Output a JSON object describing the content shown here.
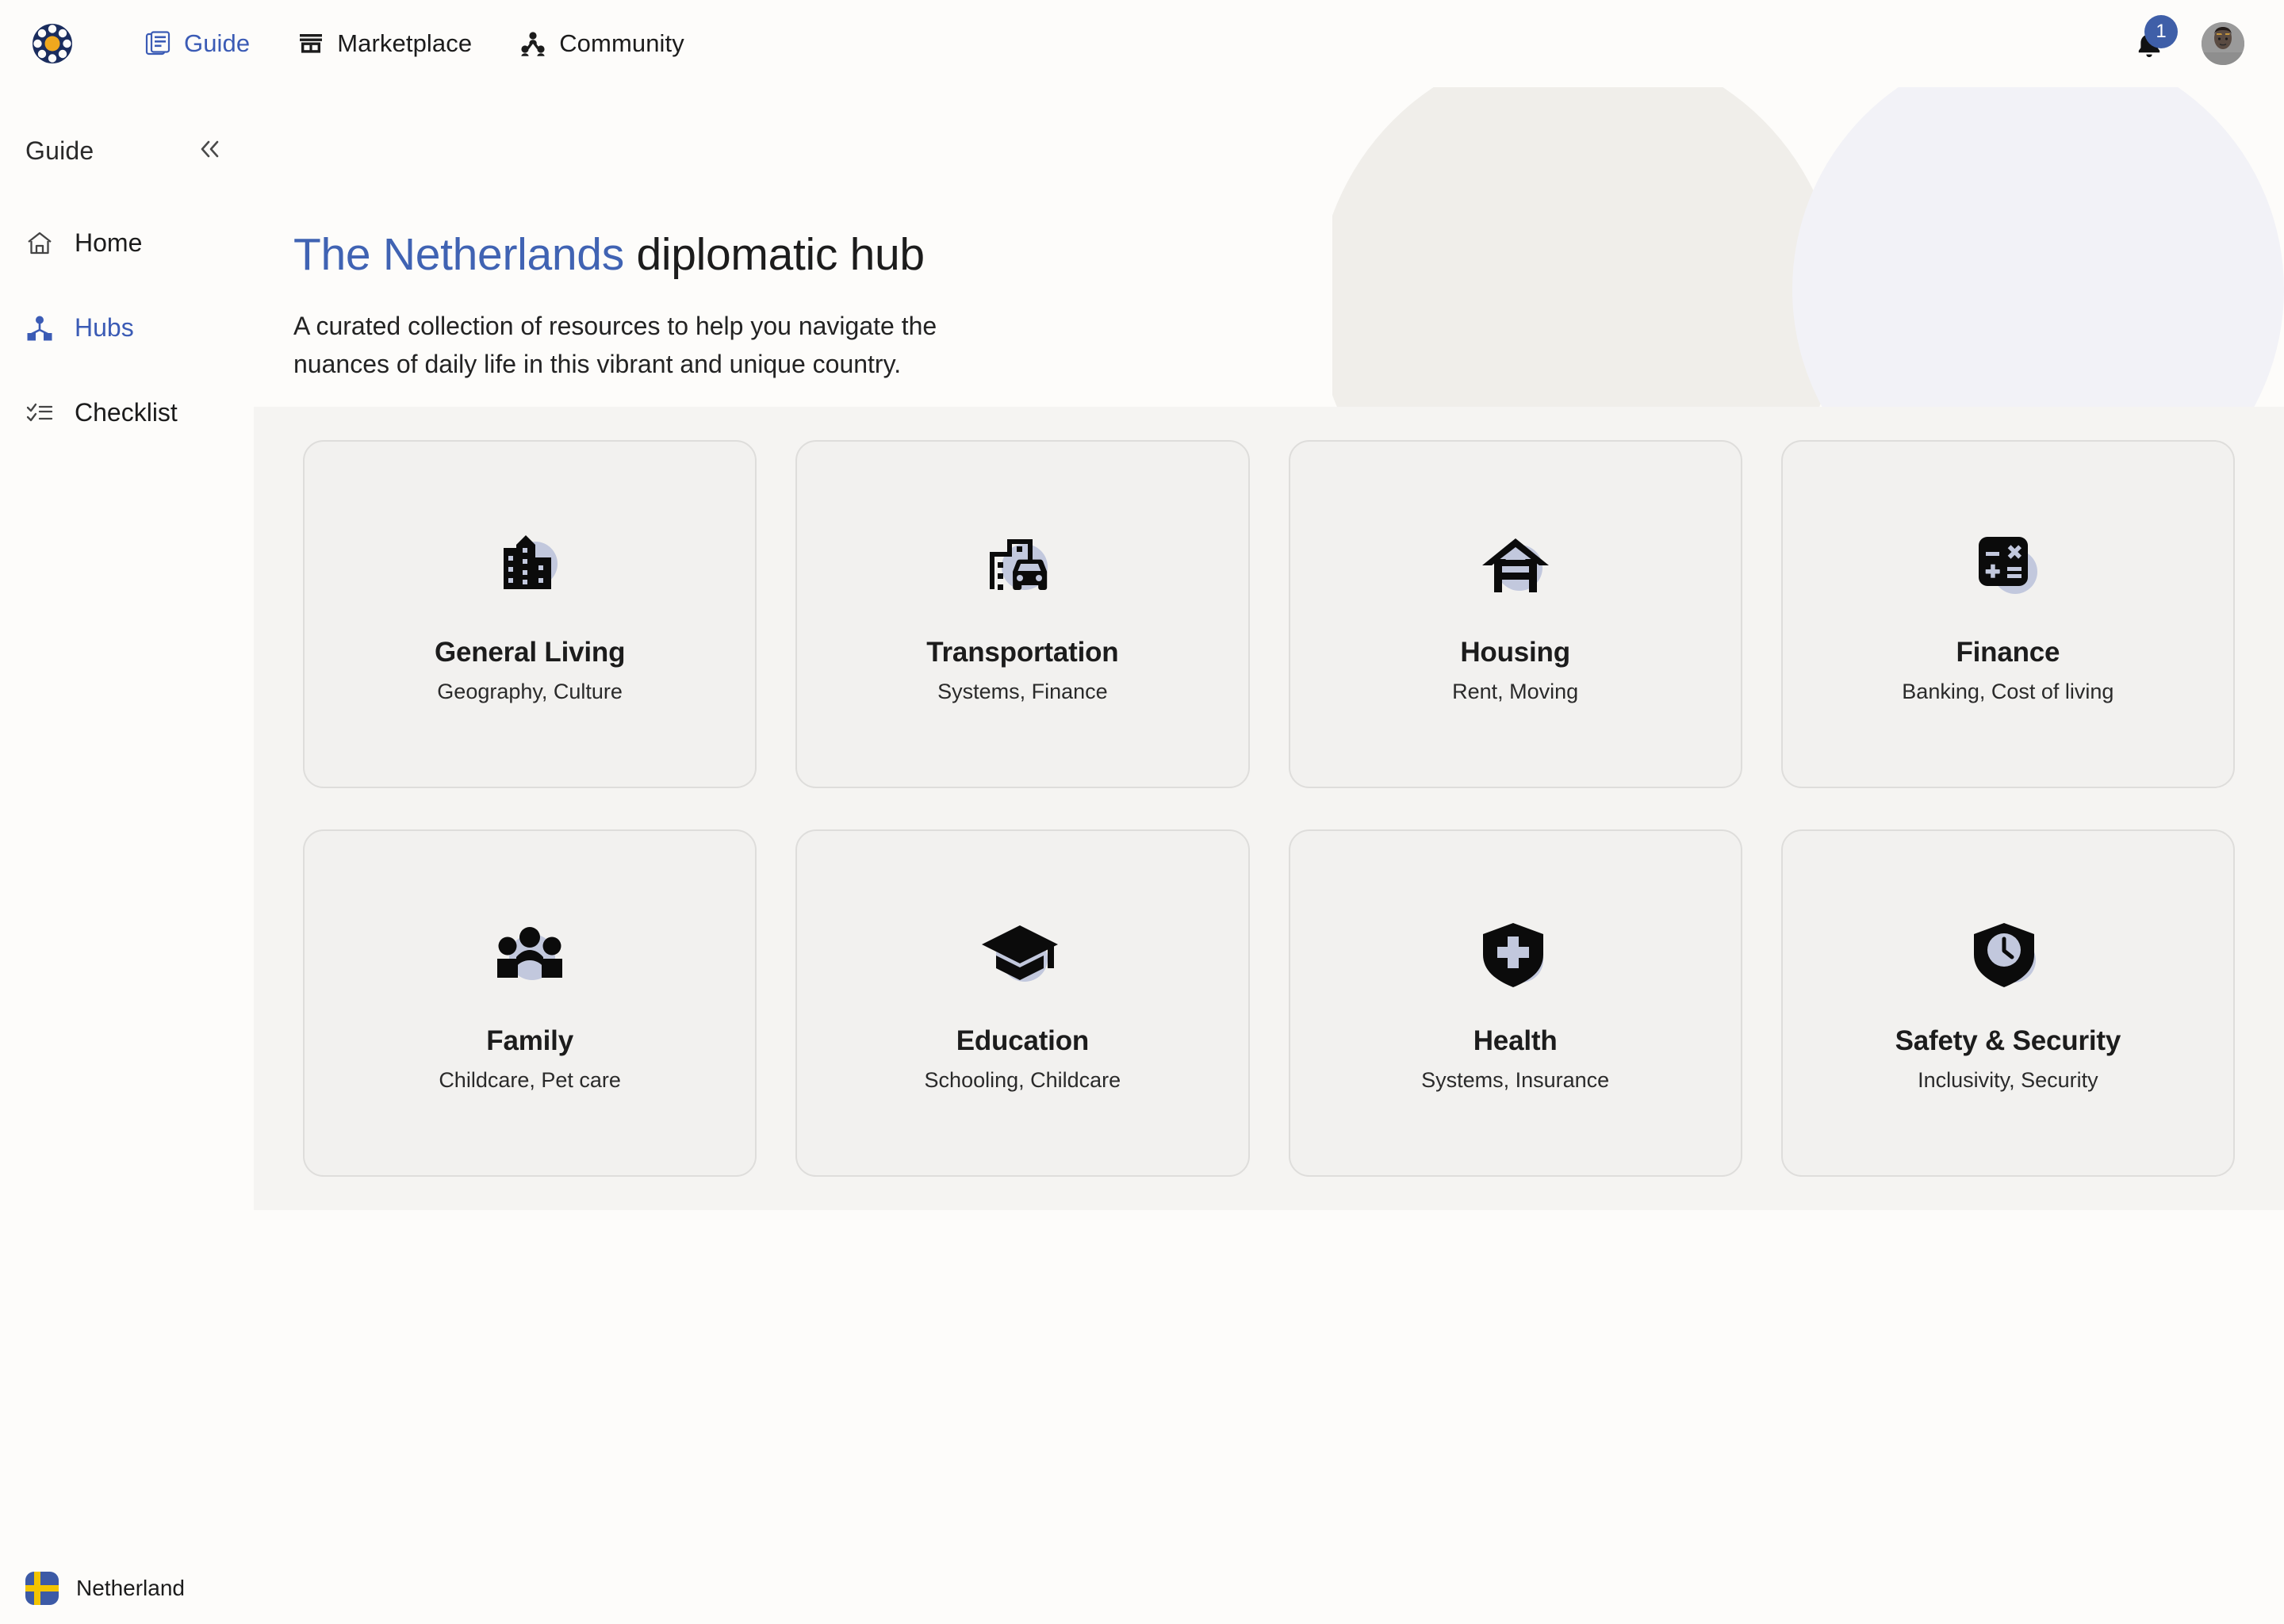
{
  "topnav": {
    "logo_icon": "app-logo-emblem",
    "items": [
      {
        "label": "Guide",
        "icon": "book-document-icon",
        "active": true
      },
      {
        "label": "Marketplace",
        "icon": "storefront-icon",
        "active": false
      },
      {
        "label": "Community",
        "icon": "people-group-icon",
        "active": false
      }
    ],
    "notifications": {
      "icon": "bell-icon",
      "count": "1",
      "badge_color": "#3f5fa8"
    },
    "avatar": {
      "icon": "user-avatar",
      "alt": "User profile"
    }
  },
  "sidebar": {
    "title": "Guide",
    "collapse_icon": "chevron-double-left-icon",
    "items": [
      {
        "label": "Home",
        "icon": "home-icon",
        "active": false
      },
      {
        "label": "Hubs",
        "icon": "hubs-network-icon",
        "active": true
      },
      {
        "label": "Checklist",
        "icon": "checklist-icon",
        "active": false
      }
    ]
  },
  "hero": {
    "title_highlight": "The Netherlands",
    "title_rest": "diplomatic hub",
    "subtitle": "A curated collection of resources to help you navigate the nuances of daily life in this vibrant and unique country."
  },
  "hubs": [
    {
      "title": "General Living",
      "subtitle": "Geography, Culture",
      "icon": "city-buildings-icon"
    },
    {
      "title": "Transportation",
      "subtitle": "Systems, Finance",
      "icon": "car-city-icon"
    },
    {
      "title": "Housing",
      "subtitle": "Rent, Moving",
      "icon": "house-icon"
    },
    {
      "title": "Finance",
      "subtitle": "Banking, Cost of living",
      "icon": "calculator-icon"
    },
    {
      "title": "Family",
      "subtitle": "Childcare, Pet care",
      "icon": "family-group-icon"
    },
    {
      "title": "Education",
      "subtitle": "Schooling, Childcare",
      "icon": "graduation-cap-icon"
    },
    {
      "title": "Health",
      "subtitle": "Systems, Insurance",
      "icon": "shield-cross-icon"
    },
    {
      "title": "Safety & Security",
      "subtitle": "Inclusivity, Security",
      "icon": "shield-clock-icon"
    }
  ],
  "footer": {
    "country_label": "Netherland",
    "flag_icon": "flag-icon"
  },
  "colors": {
    "accent_blue": "#3b5bb5",
    "title_blue": "#4063b3",
    "badge_blue": "#3f5fa8",
    "page_bg": "#fdfcfa",
    "panel_bg": "#f5f4f2",
    "card_bg": "#f2f1ef",
    "card_border": "#dedddb",
    "icon_circle": "#c2c8dd",
    "icon_dark": "#0b0b0b",
    "blob_warm": "#f0eeea",
    "blob_cool": "#f2f2f7"
  }
}
